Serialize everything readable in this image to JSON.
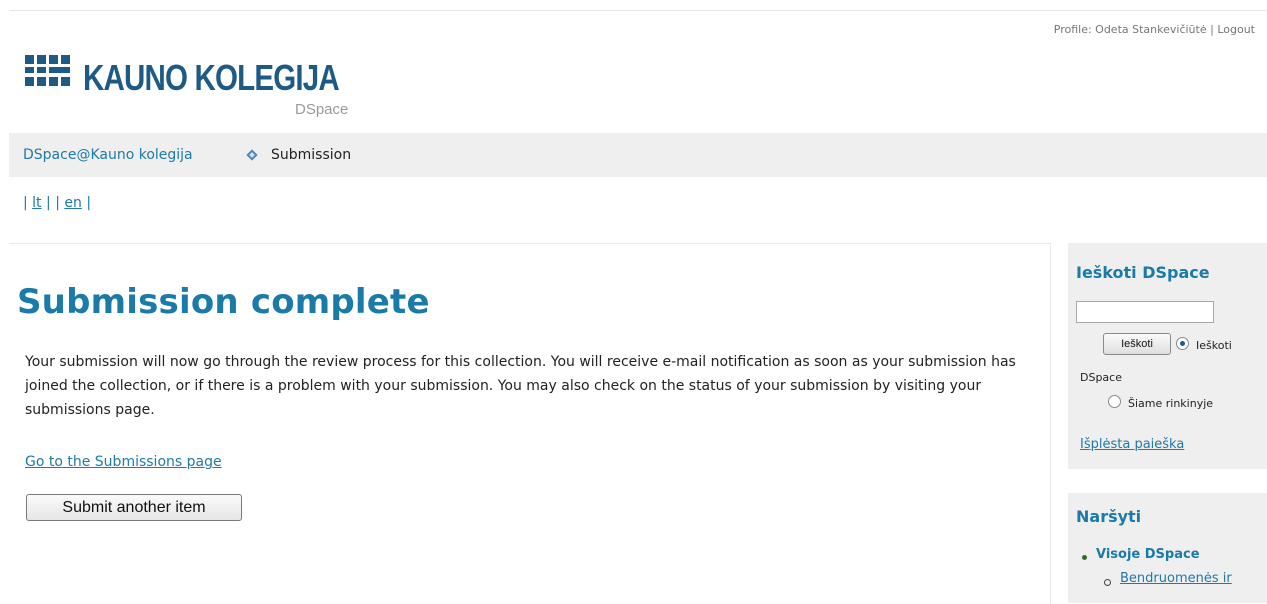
{
  "header": {
    "profile_text": "Profile: Odeta Stankevičiūtė",
    "separator": "|",
    "logout": "Logout",
    "logo_title": "KAUNO KOLEGIJA",
    "logo_sub": "DSpace",
    "brand_color": "#1e5a86"
  },
  "breadcrumb": {
    "home": "DSpace@Kauno kolegija",
    "current": "Submission"
  },
  "language": {
    "pipe": "|",
    "items": [
      "lt",
      "en"
    ]
  },
  "main": {
    "title": "Submission complete",
    "body": "Your submission will now go through the review process for this collection. You will receive e-mail notification as soon as your submission has joined the collection, or if there is a problem with your submission. You may also check on the status of your submission by visiting your submissions page.",
    "submissions_link": "Go to the Submissions page",
    "submit_another": "Submit another item"
  },
  "sidebar": {
    "search": {
      "title": "Ieškoti DSpace",
      "input_value": "",
      "button": "Ieškoti",
      "radio_dspace_label_1": "Ieškoti",
      "radio_dspace_label_2": "DSpace",
      "radio_collection_label": "Šiame rinkinyje",
      "advanced_link": "Išplėsta paieška"
    },
    "browse": {
      "title": "Naršyti",
      "item": "Visoje DSpace",
      "sub_item": "Bendruomenės ir"
    }
  },
  "colors": {
    "link": "#1f7aa6",
    "heading": "#1a7aa8",
    "panel": "#efefef"
  }
}
